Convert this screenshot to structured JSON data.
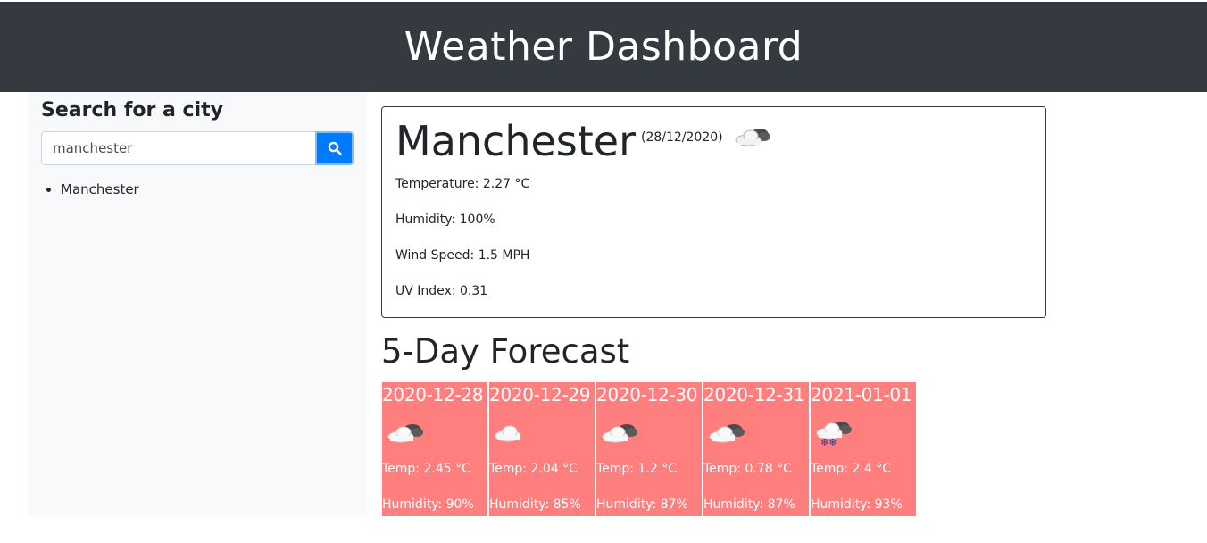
{
  "header": {
    "title": "Weather Dashboard"
  },
  "sidebar": {
    "title": "Search for a city",
    "search_value": "manchester",
    "search_button_icon": "search-icon",
    "history": [
      "Manchester"
    ]
  },
  "current": {
    "city": "Manchester",
    "date": "(28/12/2020)",
    "icon": "cloudy-icon",
    "temperature": "Temperature: 2.27 °C",
    "humidity": "Humidity: 100%",
    "wind": "Wind Speed: 1.5 MPH",
    "uv": "UV Index: 0.31"
  },
  "forecast": {
    "title": "5-Day Forecast",
    "card_color": "#ff7f7f",
    "days": [
      {
        "date": "2020-12-28",
        "icon": "broken-clouds-icon",
        "temp": "Temp: 2.45 °C",
        "humidity": "Humidity: 90%"
      },
      {
        "date": "2020-12-29",
        "icon": "cloud-icon",
        "temp": "Temp: 2.04 °C",
        "humidity": "Humidity: 85%"
      },
      {
        "date": "2020-12-30",
        "icon": "broken-clouds-icon",
        "temp": "Temp: 1.2 °C",
        "humidity": "Humidity: 87%"
      },
      {
        "date": "2020-12-31",
        "icon": "broken-clouds-icon",
        "temp": "Temp: 0.78 °C",
        "humidity": "Humidity: 87%"
      },
      {
        "date": "2021-01-01",
        "icon": "snow-icon",
        "temp": "Temp: 2.4 °C",
        "humidity": "Humidity: 93%"
      }
    ]
  }
}
